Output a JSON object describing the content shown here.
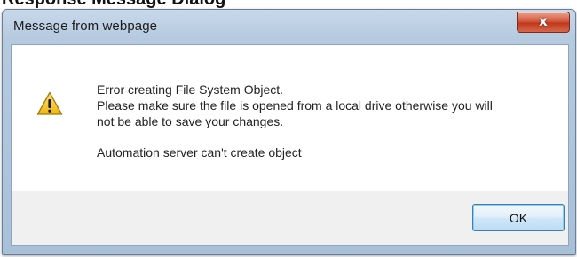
{
  "page": {
    "top_caption": "Response Message Dialog"
  },
  "dialog": {
    "title": "Message from webpage",
    "close_glyph": "x",
    "icon": "warning-icon",
    "lines": [
      "Error creating File System Object.",
      "Please make sure the file is opened from a local drive otherwise you will",
      "not be able to save your changes."
    ],
    "secondary": "Automation server can't create object",
    "ok_label": "OK"
  },
  "colors": {
    "frame": "#b5cadf",
    "close_button": "#c0381d",
    "warning": "#f2c21b",
    "ok_border": "#3c7fb1"
  }
}
